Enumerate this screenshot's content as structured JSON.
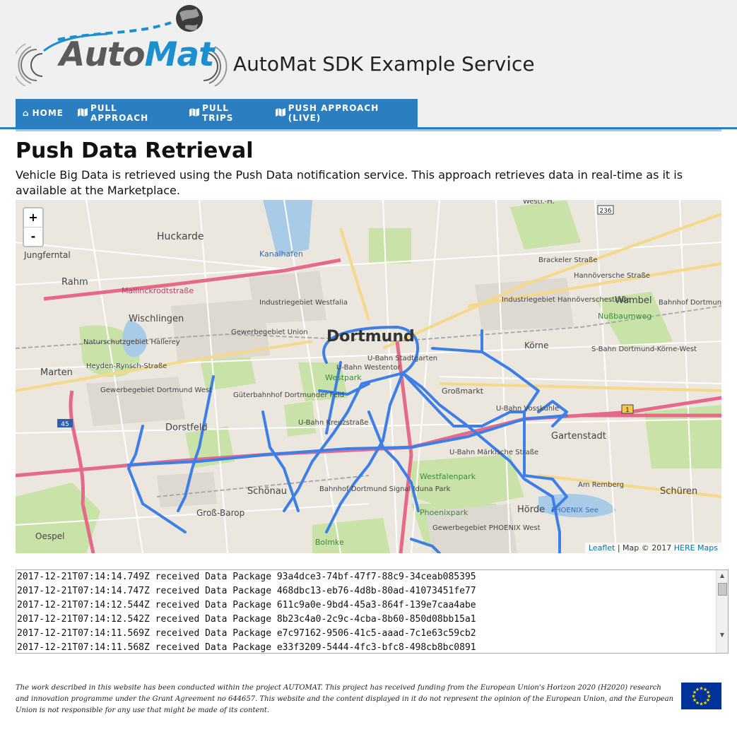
{
  "header": {
    "logo_text_part1": "Auto",
    "logo_text_part2": "Mat",
    "service_title": "AutoMat SDK Example Service"
  },
  "nav": {
    "items": [
      {
        "icon": "home-icon",
        "label": "HOME"
      },
      {
        "icon": "map-icon",
        "label": "PULL APPROACH"
      },
      {
        "icon": "map-icon",
        "label": "PULL TRIPS"
      },
      {
        "icon": "map-icon",
        "label": "PUSH APPROACH (LIVE)"
      }
    ]
  },
  "main": {
    "title": "Push Data Retrieval",
    "intro": "Vehicle Big Data is retrieved using the Push Data notification service. This approach retrieves data in real-time as it is available at the Marketplace."
  },
  "map": {
    "zoom_in": "+",
    "zoom_out": "-",
    "attribution_link1": "Leaflet",
    "attribution_sep": " | Map © 2017 ",
    "attribution_link2": "HERE Maps",
    "labels": [
      {
        "text": "Dortmund",
        "cls": "city"
      },
      {
        "text": "Huckarde"
      },
      {
        "text": "Jungferntal"
      },
      {
        "text": "Rahm"
      },
      {
        "text": "Wischlingen"
      },
      {
        "text": "Marten"
      },
      {
        "text": "Dorstfeld"
      },
      {
        "text": "Schönau"
      },
      {
        "text": "Groß-Barop"
      },
      {
        "text": "Oespel"
      },
      {
        "text": "Körne"
      },
      {
        "text": "Wambel"
      },
      {
        "text": "Gartenstadt"
      },
      {
        "text": "Schüren"
      },
      {
        "text": "Hörde"
      },
      {
        "text": "Westpark"
      },
      {
        "text": "Westfalenpark"
      },
      {
        "text": "Phoenixpark"
      },
      {
        "text": "Bolmke"
      },
      {
        "text": "Kanalhafen"
      },
      {
        "text": "Großmarkt"
      },
      {
        "text": "Nußbaumweg"
      },
      {
        "text": "Mallinckrodtstraße"
      },
      {
        "text": "Brackeler Straße"
      },
      {
        "text": "Hannöversche Straße"
      },
      {
        "text": "Heyden-Rynsch-Straße"
      },
      {
        "text": "Am Remberg"
      },
      {
        "text": "PHOENIX See"
      },
      {
        "text": "Industriegebiet Westfalia"
      },
      {
        "text": "Industriegebiet Hannöverschestraße"
      },
      {
        "text": "Naturschutzgebiet Hallerey"
      },
      {
        "text": "Gewerbegebiet Dortmund West"
      },
      {
        "text": "Gewerbegebiet Union"
      },
      {
        "text": "Gewerbegebiet PHOENIX West"
      },
      {
        "text": "Güterbahnhof Dortmunder Feld"
      },
      {
        "text": "Bahnhof Dortmund Signal Iduna Park"
      },
      {
        "text": "Bahnhof Dortmund Knappschaftskh."
      },
      {
        "text": "U-Bahn Stadtgarten"
      },
      {
        "text": "U-Bahn Westentor"
      },
      {
        "text": "U-Bahn Kreuzstraße"
      },
      {
        "text": "U-Bahn Märkische Straße"
      },
      {
        "text": "U-Bahn Vosskuhle"
      },
      {
        "text": "S-Bahn Dortmund-Körne-West"
      },
      {
        "text": "Westf.-H."
      },
      {
        "text": "236"
      },
      {
        "text": "45"
      },
      {
        "text": "1"
      }
    ]
  },
  "log": {
    "lines": [
      "2017-12-21T07:14:14.749Z received Data Package 93a4dce3-74bf-47f7-88c9-34ceab085395",
      "2017-12-21T07:14:14.747Z received Data Package 468dbc13-eb76-4d8b-80ad-41073451fe77",
      "2017-12-21T07:14:12.544Z received Data Package 611c9a0e-9bd4-45a3-864f-139e7caa4abe",
      "2017-12-21T07:14:12.542Z received Data Package 8b23c4a0-2c9c-4cba-8b60-850d08bb15a1",
      "2017-12-21T07:14:11.569Z received Data Package e7c97162-9506-41c5-aaad-7c1e63c59cb2",
      "2017-12-21T07:14:11.568Z received Data Package e33f3209-5444-4fc3-bfc8-498cb8bc0891"
    ]
  },
  "footer": {
    "text": "The work described in this website has been conducted within the project AUTOMAT. This project has received funding from the European Union's Horizon 2020 (H2020) research and innovation programme under the Grant Agreement no 644657. This website and the content displayed in it do not represent the opinion of the European Union, and the European Union is not responsible for any use that might be made of its content."
  },
  "colors": {
    "brand_blue": "#2b7fc1",
    "logo_blue": "#1c8fcf",
    "route_blue": "#3d7fe6",
    "highway_pink": "#e56a8a",
    "eu_blue": "#003399",
    "eu_gold": "#ffdd00"
  }
}
